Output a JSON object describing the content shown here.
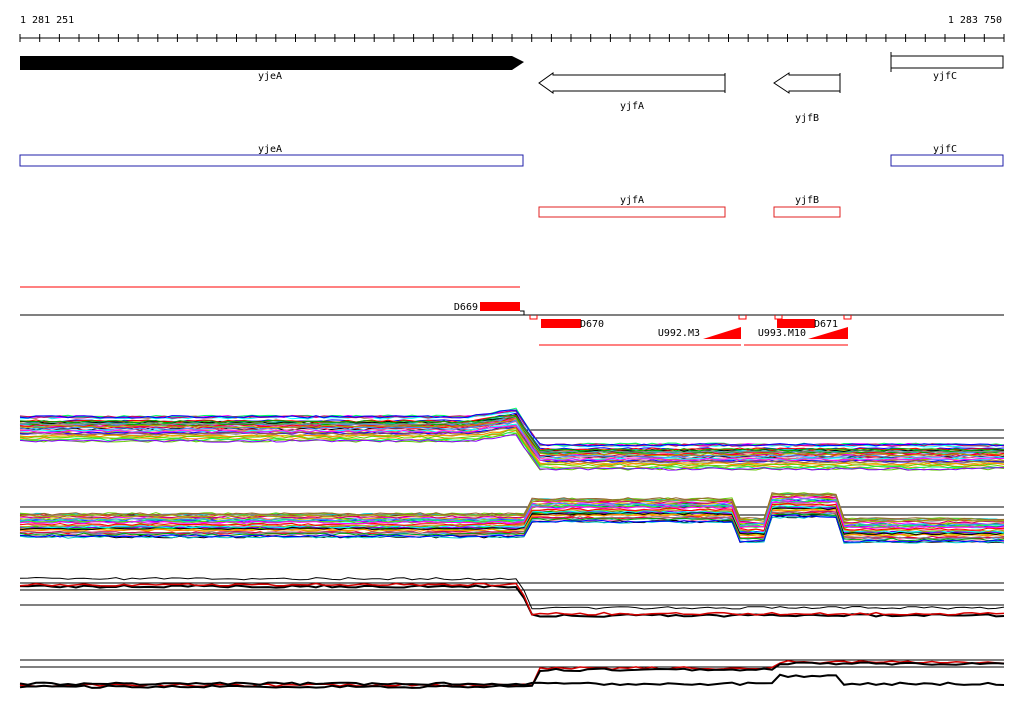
{
  "ruler": {
    "start_label": "1 281 251",
    "end_label": "1 283 750"
  },
  "genes_top": [
    {
      "label": "yjeA",
      "strand": "+",
      "style": "filled"
    },
    {
      "label": "yjfA",
      "strand": "-",
      "style": "outline"
    },
    {
      "label": "yjfB",
      "strand": "-",
      "style": "outline"
    },
    {
      "label": "yjfC",
      "strand": "+",
      "style": "outline"
    }
  ],
  "transcripts": [
    {
      "label": "yjeA",
      "color": "#1f1fa8"
    },
    {
      "label": "yjfC",
      "color": "#1f1fa8"
    },
    {
      "label": "yjfA",
      "color": "#e02020"
    },
    {
      "label": "yjfB",
      "color": "#e02020"
    }
  ],
  "features": {
    "d669": "D669",
    "d670": "D670",
    "d671": "D671",
    "u992": "U992.M3",
    "u993": "U993.M10"
  },
  "colors": {
    "accent_red": "#ff0000",
    "blue_box": "#1f1fa8",
    "red_box": "#e02020",
    "black": "#000000"
  }
}
